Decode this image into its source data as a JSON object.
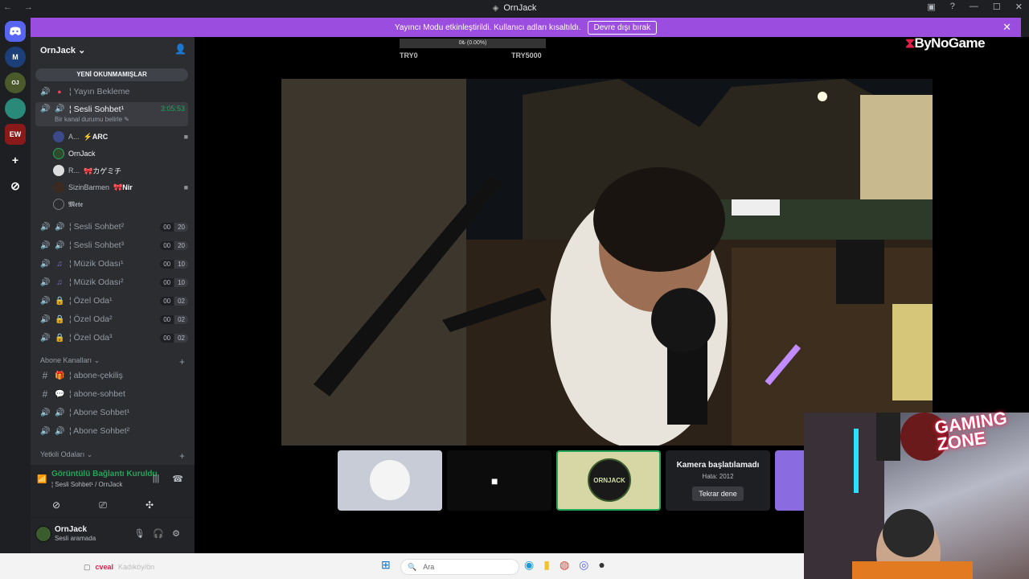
{
  "window": {
    "title": "OrnJack",
    "nav": "← →",
    "controls": [
      "▣",
      "?",
      "—",
      "☐",
      "✕"
    ]
  },
  "banner": {
    "text": "Yayıncı Modu etkinleştirildi. Kullanıcı adları kısaltıldı.",
    "button": "Devre dışı bırak",
    "close": "✕"
  },
  "servers": [
    {
      "label": "",
      "name": "discord-home-icon"
    },
    {
      "label": "M",
      "name": "server-m"
    },
    {
      "label": "OJ",
      "name": "server-ornjack"
    },
    {
      "label": "",
      "name": "server-globe"
    },
    {
      "label": "EW",
      "name": "server-ew"
    },
    {
      "label": "+",
      "name": "add-server-icon"
    },
    {
      "label": "⊘",
      "name": "explore-icon"
    }
  ],
  "sidebar": {
    "server_name": "OrnJack",
    "unread_label": "YENİ OKUNMAMIŞLAR",
    "channels": [
      {
        "label": "¦ Yayın Bekleme",
        "icon": "●"
      },
      {
        "label": "¦ Sesli Sohbet¹",
        "timer": "3:05:53",
        "sub": "Bir kanal durumu belirle ✎"
      },
      {
        "label": "¦ Sesli Sohbet²",
        "count": [
          "00",
          "20"
        ]
      },
      {
        "label": "¦ Sesli Sohbet³",
        "count": [
          "00",
          "20"
        ]
      },
      {
        "label": "¦ Müzik Odası¹",
        "count": [
          "00",
          "10"
        ]
      },
      {
        "label": "¦ Müzik Odası²",
        "count": [
          "00",
          "10"
        ]
      },
      {
        "label": "¦ Özel Oda¹",
        "count": [
          "00",
          "02"
        ]
      },
      {
        "label": "¦ Özel Oda²",
        "count": [
          "00",
          "02"
        ]
      },
      {
        "label": "¦ Özel Oda³",
        "count": [
          "00",
          "02"
        ]
      }
    ],
    "users": [
      {
        "name": "A...",
        "tag": "⚡ARC"
      },
      {
        "name": "OrnJack",
        "tag": ""
      },
      {
        "name": "R...",
        "tag": "🎀カゲミチ"
      },
      {
        "name": "SizinBarmen",
        "tag": "🎀Nir"
      },
      {
        "name": "𝕸𝖊𝖙𝖊",
        "tag": ""
      }
    ],
    "abone_category": "Abone Kanalları",
    "abone_channels": [
      {
        "label": "¦ abone-çekiliş",
        "icon": "#"
      },
      {
        "label": "¦ abone-sohbet",
        "icon": "#"
      },
      {
        "label": "¦ Abone Sohbet¹",
        "icon": "🔊"
      },
      {
        "label": "¦ Abone Sohbet²",
        "icon": "🔊"
      }
    ],
    "yetkili_category": "Yetkili Odaları"
  },
  "voice": {
    "status": "Görüntülü Bağlantı Kuruldu",
    "sub": "¦ Sesli Sohbet¹ / OrnJack"
  },
  "user": {
    "name": "OrnJack",
    "status": "Sesli aramada"
  },
  "stream": {
    "brand": "ByNoGame",
    "progress_label": "0₺ (0.00%)",
    "left_label": "TRY0",
    "right_label": "TRY5000",
    "progress": 0
  },
  "camera_tile": {
    "title": "Kamera başlatılamadı",
    "error": "Hata: 2012",
    "retry": "Tekrar dene"
  },
  "overlay": {
    "gaming_zone": "GAMING\nZONE"
  },
  "taskbar": {
    "app": "cveal",
    "app_sub": "Kadıköy/ön",
    "search": "Ara"
  }
}
